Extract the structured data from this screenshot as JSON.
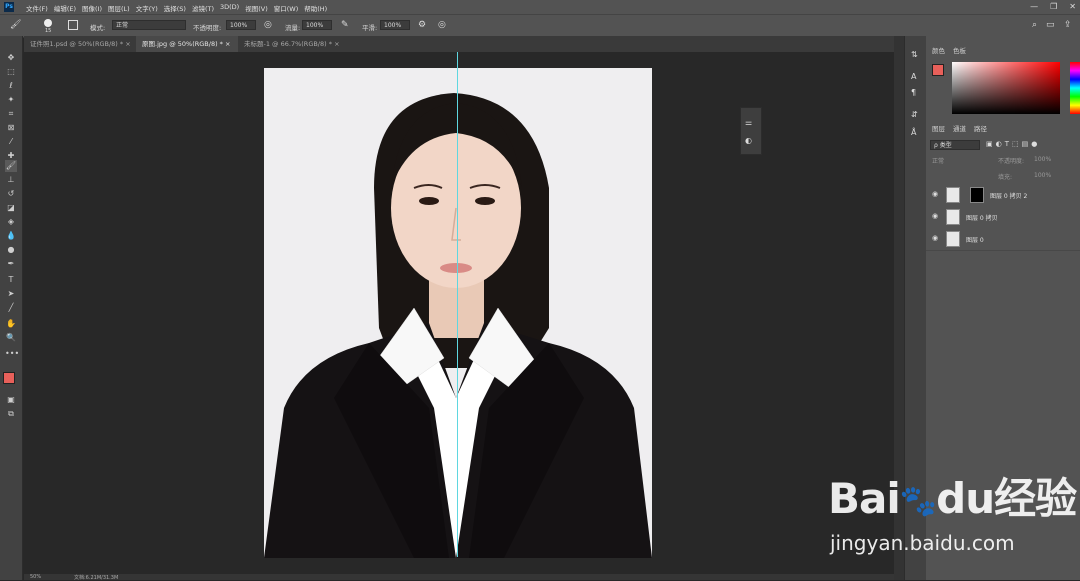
{
  "app": {
    "logo": "Ps"
  },
  "menu": {
    "items": [
      "文件(F)",
      "编辑(E)",
      "图像(I)",
      "图层(L)",
      "文字(Y)",
      "选择(S)",
      "滤镜(T)",
      "3D(D)",
      "视图(V)",
      "窗口(W)",
      "帮助(H)"
    ]
  },
  "window_controls": {
    "minimize": "—",
    "restore": "❐",
    "close": "✕"
  },
  "options": {
    "brush_size": "15",
    "mode_label": "模式:",
    "mode_value": "正常",
    "opacity_label": "不透明度:",
    "opacity_value": "100%",
    "flow_label": "流量:",
    "flow_value": "100%",
    "smooth_label": "平滑:",
    "smooth_value": "100%"
  },
  "tabs": [
    {
      "label": "证件照1.psd @ 50%(RGB/8) *",
      "close": "×"
    },
    {
      "label": "原图.jpg @ 50%(RGB/8) *",
      "close": "×"
    },
    {
      "label": "未标题-1 @ 66.7%(RGB/8) *",
      "close": "×"
    }
  ],
  "right_panel": {
    "color_tabs": [
      "颜色",
      "色板"
    ],
    "layer_tabs": [
      "图层",
      "通道",
      "路径"
    ],
    "filter_label": "ρ 类型",
    "blend_mode": "正常",
    "opacity_label": "不透明度:",
    "opacity_value": "100%",
    "fill_label": "填充:",
    "fill_value": "100%",
    "layers": [
      {
        "name": "图层 0 拷贝 2"
      },
      {
        "name": "图层 0 拷贝"
      },
      {
        "name": "图层 0"
      }
    ]
  },
  "status": {
    "zoom": "50%",
    "doc": "文档:6.21M/31.3M"
  },
  "watermark": {
    "brand": "Bai",
    "brand2": "du",
    "cn": "经验",
    "url": "jingyan.baidu.com"
  },
  "colors": {
    "foreground": "#e8605a",
    "background": "#ffffff",
    "guide": "#5fd7e0",
    "accent": "#e8605a"
  }
}
